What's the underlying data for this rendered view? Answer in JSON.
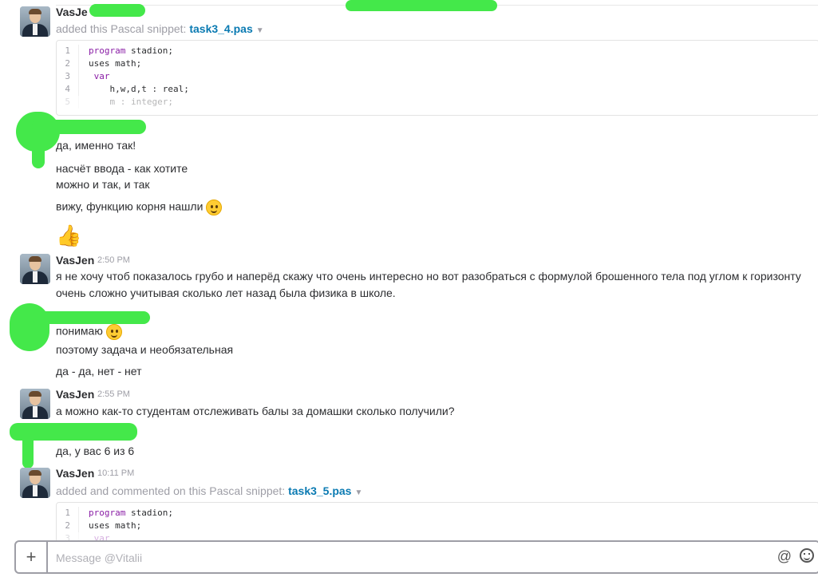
{
  "messages": {
    "m1": {
      "author": "VasJe",
      "meta_prefix": "added this Pascal snippet:",
      "snippet_name": "task3_4.pas",
      "snippet_lines": [
        {
          "num": "1",
          "kw": "program",
          "rest": " stadion;"
        },
        {
          "num": "2",
          "kw": "",
          "rest": "uses math;"
        },
        {
          "num": "3",
          "kw": " var",
          "rest": ""
        },
        {
          "num": "4",
          "kw": "",
          "rest": "    h,w,d,t : real;"
        },
        {
          "num": "5",
          "kw": "",
          "rest": "    m : integer;"
        }
      ]
    },
    "m2": {
      "lines": [
        "да, именно так!",
        "насчёт ввода - как хотите",
        "можно и так, и так",
        "вижу, функцию корня нашли"
      ]
    },
    "m3": {
      "author": "VasJen",
      "time": "2:50 PM",
      "text": "я не хочу чтоб показалось грубо и наперёд скажу что очень интересно но вот разобраться с формулой брошенного тела под углом к горизонту очень сложно учитывая сколько лет назад была физика в школе."
    },
    "m4": {
      "lines": [
        "понимаю",
        "поэтому задача и необязательная",
        "да - да, нет - нет"
      ]
    },
    "m5": {
      "author": "VasJen",
      "time": "2:55 PM",
      "text": "а можно как-то студентам отслеживать балы за домашки сколько получили?"
    },
    "m6": {
      "text": "да, у вас 6 из 6"
    },
    "m7": {
      "author": "VasJen",
      "time": "10:11 PM",
      "meta_prefix": "added and commented on this Pascal snippet:",
      "snippet_name": "task3_5.pas",
      "snippet_lines": [
        {
          "num": "1",
          "kw": "program",
          "rest": " stadion;"
        },
        {
          "num": "2",
          "kw": "",
          "rest": "uses math;"
        },
        {
          "num": "3",
          "kw": " var",
          "rest": ""
        }
      ]
    }
  },
  "composer": {
    "placeholder": "Message @Vitalii"
  },
  "icons": {
    "attach": "plus-icon",
    "mention": "at-icon",
    "emoji": "smile-icon",
    "reaction": "thumbs-up-icon"
  }
}
